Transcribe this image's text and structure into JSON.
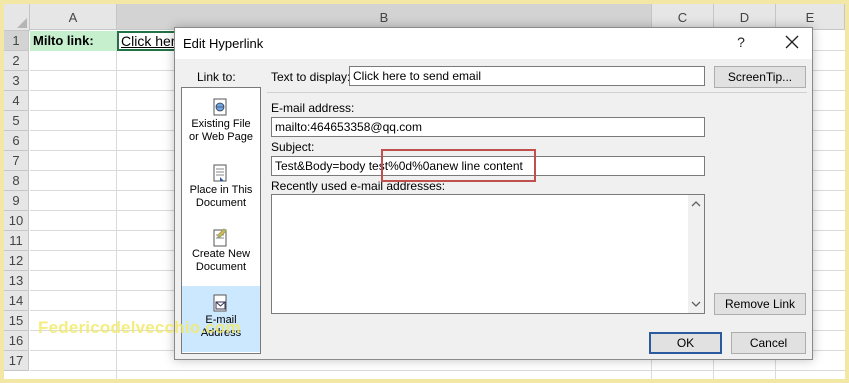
{
  "spreadsheet": {
    "columns": [
      "A",
      "B",
      "C",
      "D",
      "E"
    ],
    "rows": [
      "1",
      "2",
      "3",
      "4",
      "5",
      "6",
      "7",
      "8",
      "9",
      "10",
      "11",
      "12",
      "13",
      "14",
      "15",
      "16",
      "17"
    ],
    "cell_a1": "Milto link:",
    "cell_b1": "Click here to send email",
    "accent_color": "#217346"
  },
  "dialog": {
    "title": "Edit Hyperlink",
    "help": "?",
    "link_to_label": "Link to:",
    "link_options": [
      {
        "line1": "Existing File",
        "line2": "or Web Page",
        "icon": "web-page-icon"
      },
      {
        "line1": "Place in This",
        "line2": "Document",
        "icon": "document-place-icon"
      },
      {
        "line1": "Create New",
        "line2": "Document",
        "icon": "new-document-icon"
      },
      {
        "line1": "E-mail",
        "line2": "Address",
        "icon": "email-icon"
      }
    ],
    "selected_link_option": "E-mail Address",
    "text_to_display_label": "Text to display:",
    "text_to_display_value": "Click here to send email",
    "screentip_button": "ScreenTip...",
    "email_label": "E-mail address:",
    "email_value": "mailto:464653358@qq.com",
    "subject_label": "Subject:",
    "subject_value": "Test&Body=body test%0d%0anew line content",
    "recent_label": "Recently used e-mail addresses:",
    "remove_link_button": "Remove Link",
    "ok_button": "OK",
    "cancel_button": "Cancel",
    "highlight_color": "#c0504d",
    "selection_color": "#cce8ff"
  },
  "watermark": "Federicodelvecchio.com"
}
